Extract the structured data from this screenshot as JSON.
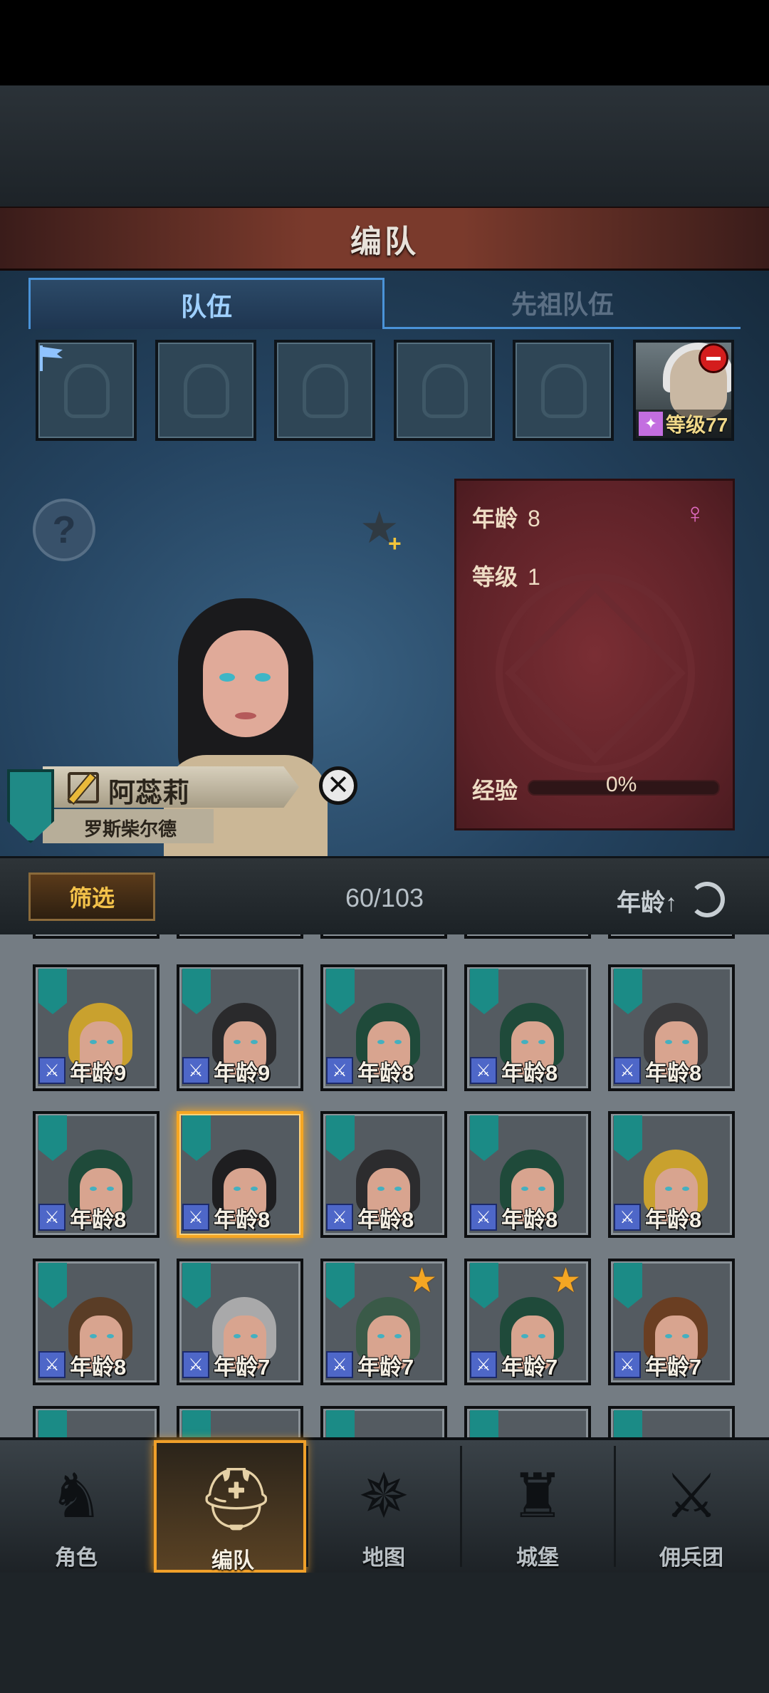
{
  "title": "编队",
  "tabs": [
    {
      "label": "队伍",
      "active": true
    },
    {
      "label": "先祖队伍",
      "active": false
    }
  ],
  "leader": {
    "level_label": "等级77"
  },
  "character": {
    "name": "阿蕊莉",
    "house": "罗斯柴尔德",
    "stats": {
      "age_label": "年龄",
      "age_value": "8",
      "level_label": "等级",
      "level_value": "1",
      "exp_label": "经验",
      "exp_value": "0%",
      "exp_fraction": 0
    },
    "gender": "female"
  },
  "filter": {
    "filter_label": "筛选",
    "count": "60/103",
    "sort_label": "年龄↑"
  },
  "roster": [
    {
      "age": "年龄9",
      "hair": "#c9a12e",
      "star": false,
      "selected": false
    },
    {
      "age": "年龄9",
      "hair": "#2a2a2c",
      "star": false,
      "selected": false
    },
    {
      "age": "年龄8",
      "hair": "#1f4a3a",
      "star": false,
      "selected": false
    },
    {
      "age": "年龄8",
      "hair": "#1f4a3a",
      "star": false,
      "selected": false
    },
    {
      "age": "年龄8",
      "hair": "#3a3a3c",
      "star": false,
      "selected": false
    },
    {
      "age": "年龄8",
      "hair": "#1f4a3a",
      "star": false,
      "selected": false
    },
    {
      "age": "年龄8",
      "hair": "#1e1e20",
      "star": false,
      "selected": true
    },
    {
      "age": "年龄8",
      "hair": "#2c2c2e",
      "star": false,
      "selected": false
    },
    {
      "age": "年龄8",
      "hair": "#1f4a3a",
      "star": false,
      "selected": false
    },
    {
      "age": "年龄8",
      "hair": "#c9a12e",
      "star": false,
      "selected": false
    },
    {
      "age": "年龄8",
      "hair": "#5a3d26",
      "star": false,
      "selected": false
    },
    {
      "age": "年龄7",
      "hair": "#a9a9aa",
      "star": false,
      "selected": false
    },
    {
      "age": "年龄7",
      "hair": "#3a5a48",
      "star": true,
      "selected": false
    },
    {
      "age": "年龄7",
      "hair": "#1f4a3a",
      "star": true,
      "selected": false
    },
    {
      "age": "年龄7",
      "hair": "#6a3e22",
      "star": false,
      "selected": false
    }
  ],
  "nav": [
    {
      "label": "角色",
      "icon": "knight-icon",
      "active": false
    },
    {
      "label": "编队",
      "icon": "helmet-icon",
      "active": true
    },
    {
      "label": "地图",
      "icon": "compass-icon",
      "active": false
    },
    {
      "label": "城堡",
      "icon": "castle-icon",
      "active": false
    },
    {
      "label": "佣兵团",
      "icon": "mercenary-icon",
      "active": false
    }
  ],
  "colors": {
    "accent": "#f0a02a",
    "tab_blue": "#4a93d8",
    "card_red": "#5e2228",
    "banner_teal": "#1b8b86"
  }
}
